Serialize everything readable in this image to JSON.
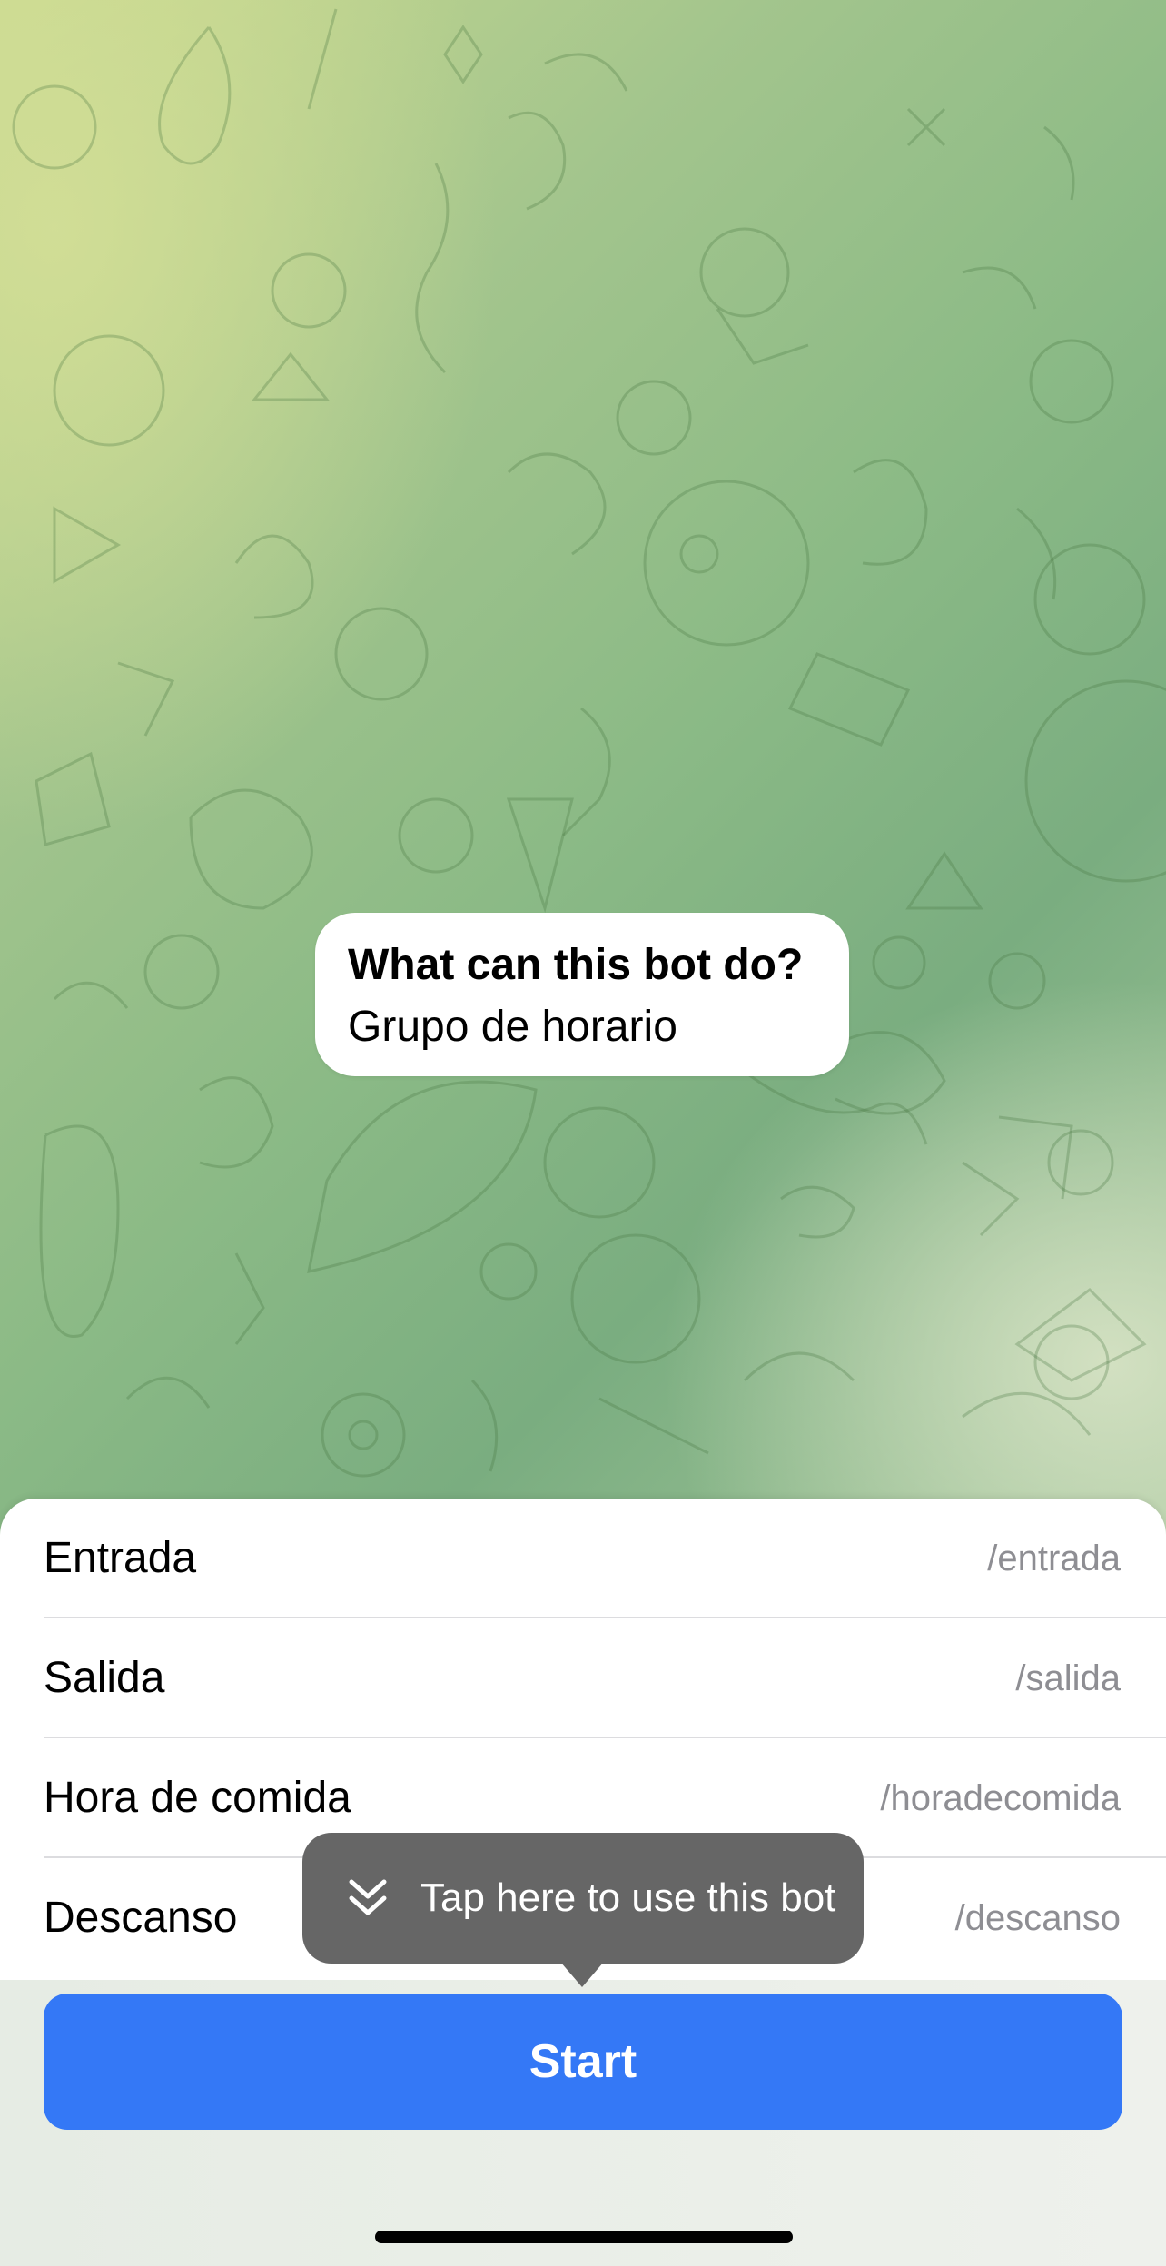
{
  "bot_info": {
    "title": "What can this bot do?",
    "description": "Grupo de horario"
  },
  "commands": [
    {
      "label": "Entrada",
      "command": "/entrada"
    },
    {
      "label": "Salida",
      "command": "/salida"
    },
    {
      "label": "Hora de comida",
      "command": "/horadecomida"
    },
    {
      "label": "Descanso",
      "command": "/descanso"
    }
  ],
  "tooltip": {
    "text": "Tap here to use this bot",
    "icon": "double-chevron-down-icon"
  },
  "start_button": {
    "label": "Start"
  },
  "colors": {
    "accent": "#3478f6",
    "tooltip_bg": "#666666",
    "secondary_text": "#8e8e93"
  }
}
